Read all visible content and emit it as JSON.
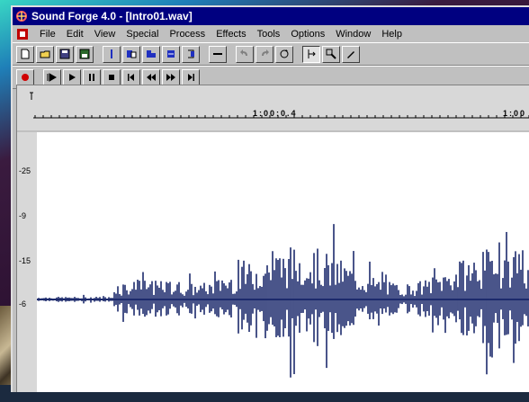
{
  "window": {
    "title": "Sound Forge 4.0 - [Intro01.wav]"
  },
  "menu": {
    "items": [
      "File",
      "Edit",
      "View",
      "Special",
      "Process",
      "Effects",
      "Tools",
      "Options",
      "Window",
      "Help"
    ]
  },
  "toolbar": {
    "row1": [
      "new-icon",
      "open-icon",
      "save-icon",
      "save-as-icon",
      "cut-icon",
      "copy-icon",
      "paste-icon",
      "paste-special-icon",
      "mix-icon",
      "undo-icon",
      "redo-icon",
      "repeat-icon",
      "edit-tool-icon",
      "magnify-tool-icon",
      "pencil-tool-icon"
    ],
    "transport": [
      "record-icon",
      "play-all-icon",
      "play-icon",
      "pause-icon",
      "stop-icon",
      "go-to-start-icon",
      "rewind-icon",
      "forward-icon",
      "go-to-end-icon"
    ]
  },
  "ruler": {
    "time_label_1": "1:00:0.4",
    "time_label_2": "1:00"
  },
  "y_axis": {
    "labels": [
      "-25",
      "-9",
      "-15",
      "-6"
    ]
  },
  "colors": {
    "title_bar": "#000080",
    "waveform": "#1c2a6c",
    "record": "#d00000"
  }
}
